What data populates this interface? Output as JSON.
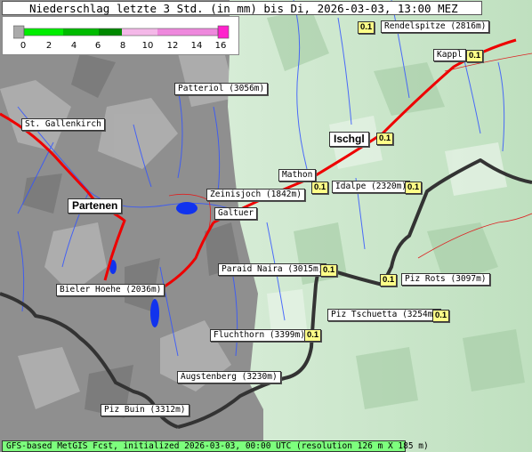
{
  "title": "Niederschlag letzte 3 Std. (in mm) bis Di, 2026-03-03, 13:00 MEZ",
  "legend": {
    "ticks": [
      "0",
      "2",
      "4",
      "6",
      "8",
      "10",
      "12",
      "14",
      "16"
    ],
    "colors": {
      "zero": "#aaaaaa",
      "light": "#00ee00",
      "medium": "#00aa00",
      "dark": "#007700",
      "pink_light": "#f4b8e8",
      "pink": "#ee77dd",
      "magenta": "#ff22cc"
    }
  },
  "places": {
    "rendelspitze": "Rendelspitze (2816m)",
    "kappl": "Kappl",
    "patteriol": "Patteriol (3056m)",
    "st_gallenkirch": "St. Gallenkirch",
    "ischgl": "Ischgl",
    "mathon": "Mathon",
    "idalpe": "Idalpe (2320m)",
    "zeinisjoch": "Zeinisjoch (1842m)",
    "partenen": "Partenen",
    "galtuer": "Galtuer",
    "paraid_naira": "Paraid Naira (3015m)",
    "piz_rots": "Piz Rots (3097m)",
    "bieler_hoehe": "Bieler Hoehe (2036m)",
    "piz_tschuetta": "Piz Tschuetta (3254m)",
    "fluchthorn": "Fluchthorn (3399m)",
    "augstenberg": "Augstenberg (3230m)",
    "piz_buin": "Piz Buin (3312m)"
  },
  "values": {
    "rendelspitze": "0.1",
    "kappl": "0.1",
    "ischgl": "0.1",
    "mathon": "0.1",
    "idalpe": "0.1",
    "paraid_naira": "0.1",
    "piz_rots": "0.1",
    "piz_tschuetta": "0.1",
    "fluchthorn": "0.1"
  },
  "footer": "GFS-based MetGIS Fcst, initialized 2026-03-03, 00:00 UTC  (resolution 126 m X 185 m)"
}
